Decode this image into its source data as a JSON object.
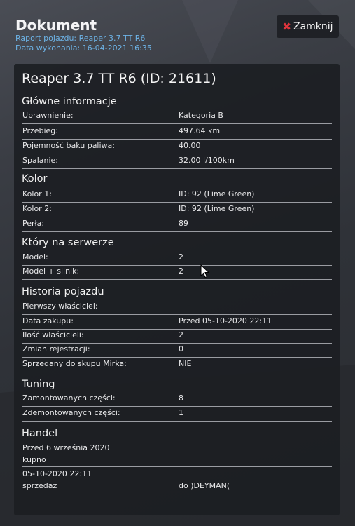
{
  "header": {
    "title": "Dokument",
    "report_line": "Raport pojazdu: Reaper 3.7 TT R6",
    "date_line": "Data wykonania: 16-04-2021 16:35"
  },
  "close_button": {
    "icon": "x-icon",
    "label": "Zamknij",
    "icon_color": "#e0343c"
  },
  "vehicle_title": "Reaper 3.7 TT R6 (ID: 21611)",
  "sections": {
    "main_info": {
      "title": "Główne informacje",
      "rows": [
        {
          "key": "Uprawnienie:",
          "value": "Kategoria B"
        },
        {
          "key": "Przebieg:",
          "value": "497.64 km"
        },
        {
          "key": "Pojemność baku paliwa:",
          "value": "40.00"
        },
        {
          "key": "Spalanie:",
          "value": "32.00 l/100km"
        }
      ]
    },
    "color": {
      "title": "Kolor",
      "rows": [
        {
          "key": "Kolor 1:",
          "value": "ID: 92 (Lime Green)"
        },
        {
          "key": "Kolor 2:",
          "value": "ID: 92 (Lime Green)"
        },
        {
          "key": "Perła:",
          "value": "89"
        }
      ]
    },
    "server": {
      "title": "Który na serwerze",
      "rows": [
        {
          "key": "Model:",
          "value": "2"
        },
        {
          "key": "Model + silnik:",
          "value": "2"
        }
      ]
    },
    "history": {
      "title": "Historia pojazdu",
      "rows": [
        {
          "key": "Pierwszy właściciel:",
          "value": ""
        },
        {
          "key": "Data zakupu:",
          "value": "Przed 05-10-2020 22:11"
        },
        {
          "key": "Ilość właścicieli:",
          "value": "2"
        },
        {
          "key": "Zmian rejestracji:",
          "value": "0"
        },
        {
          "key": "Sprzedany do skupu Mirka:",
          "value": "NIE"
        }
      ]
    },
    "tuning": {
      "title": "Tuning",
      "rows": [
        {
          "key": "Zamontowanych części:",
          "value": "8"
        },
        {
          "key": "Zdemontowanych części:",
          "value": "1"
        }
      ]
    },
    "trade": {
      "title": "Handel",
      "entries": [
        {
          "date": "Przed 6 września 2020",
          "type": "kupno",
          "party": ""
        },
        {
          "date": "05-10-2020 22:11",
          "type": "sprzedaz",
          "party": "do )DEYMAN("
        }
      ]
    }
  },
  "colors": {
    "accent_blue": "#6db3e6",
    "panel": "#1c1e22",
    "close_red": "#e0343c"
  }
}
